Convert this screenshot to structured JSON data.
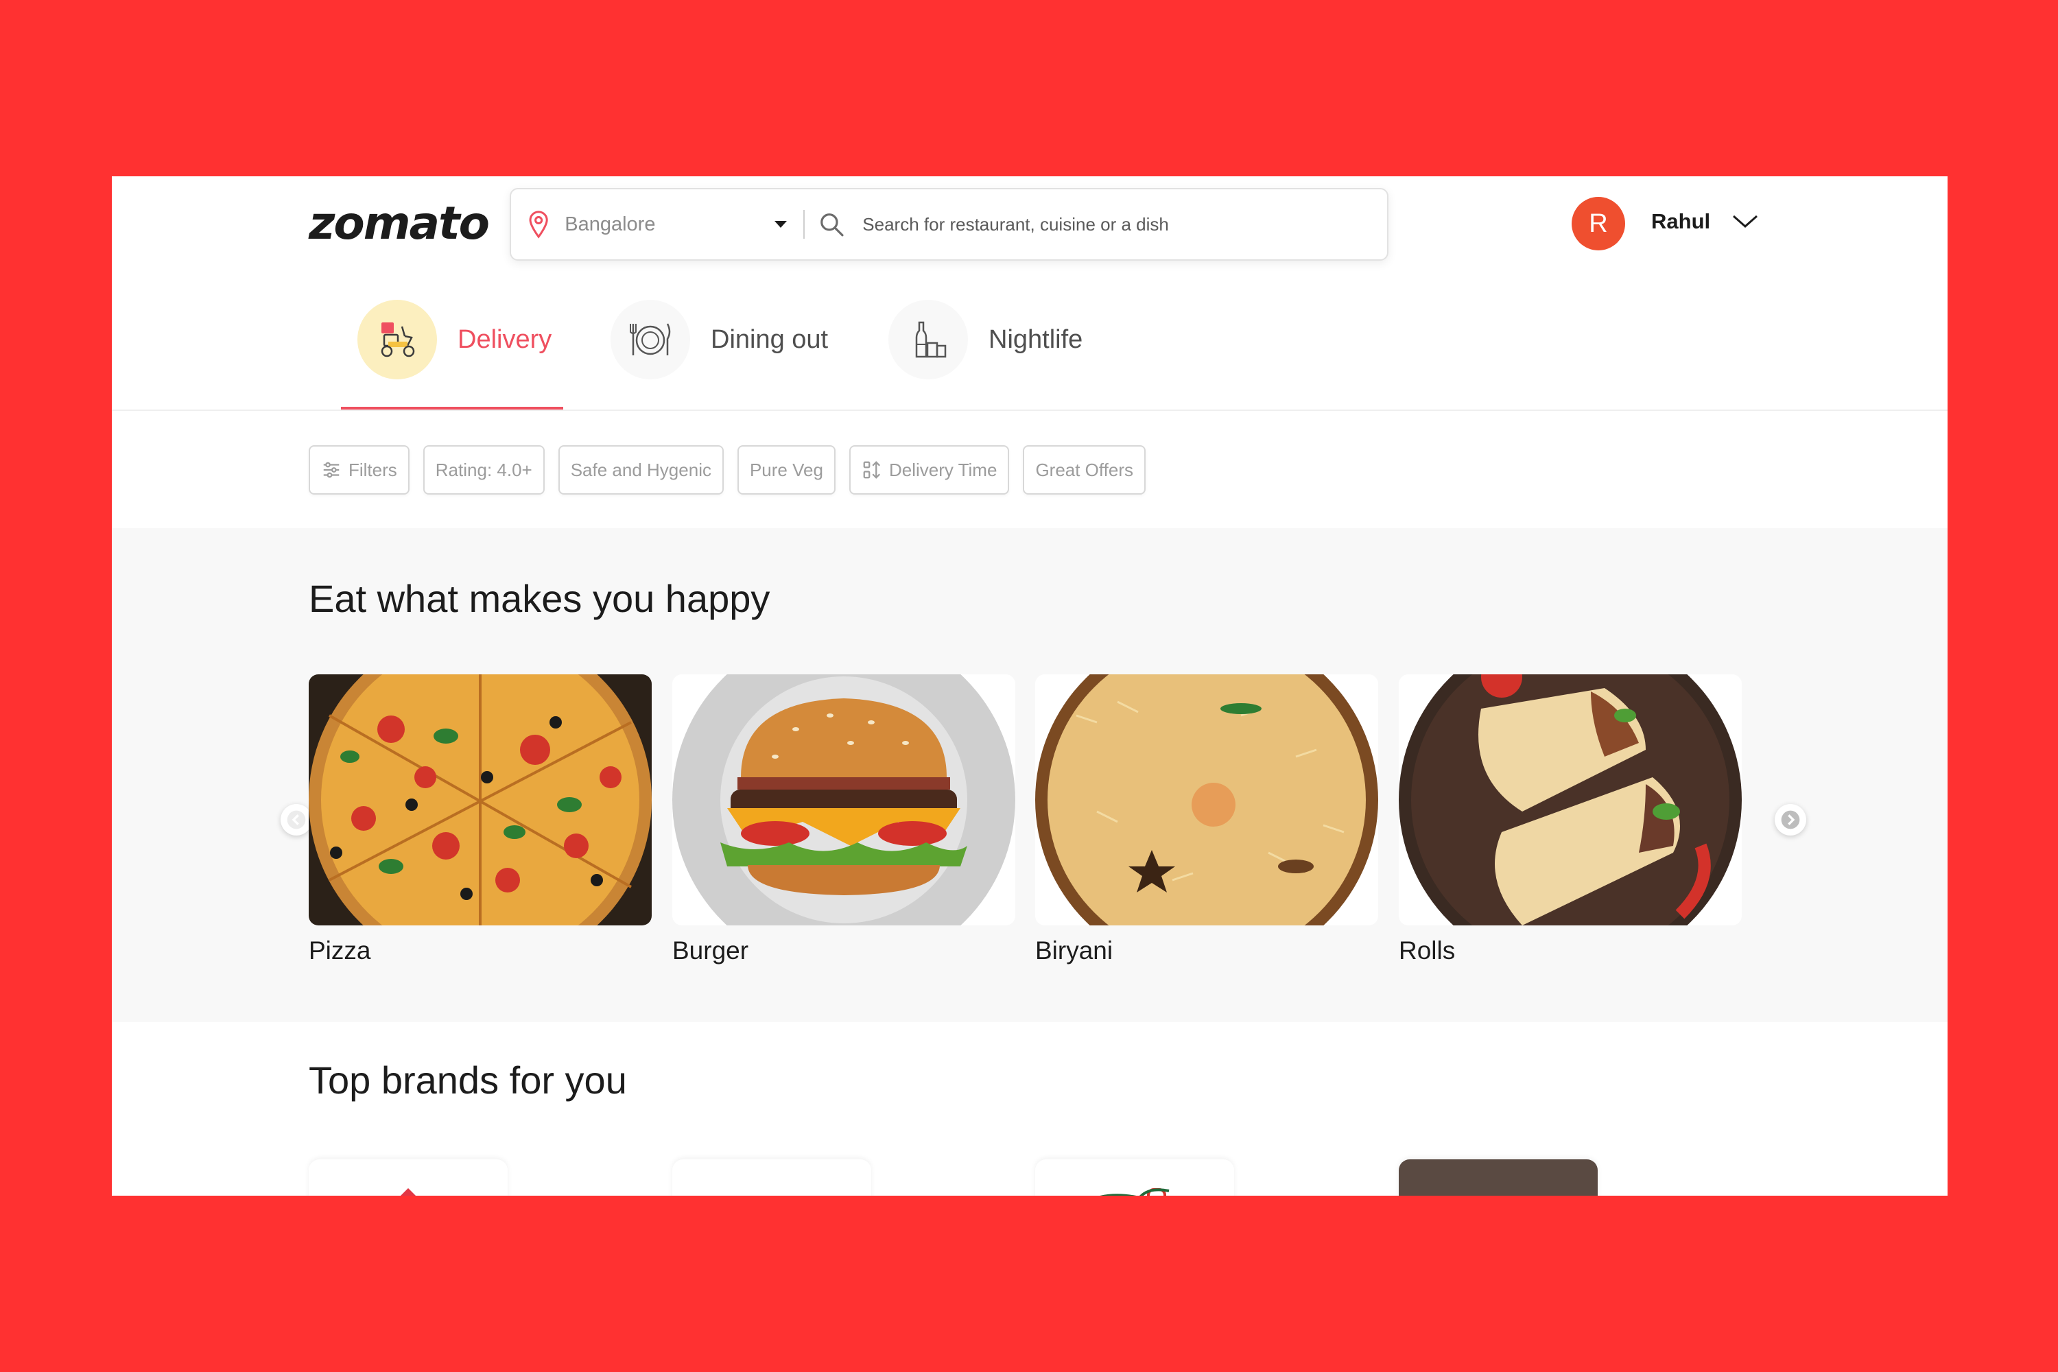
{
  "app": {
    "logo": "zomato"
  },
  "search": {
    "location": "Bangalore",
    "placeholder": "Search for restaurant, cuisine or a dish"
  },
  "user": {
    "initial": "R",
    "name": "Rahul"
  },
  "tabs": [
    {
      "label": "Delivery",
      "icon": "delivery-scooter-icon",
      "active": true
    },
    {
      "label": "Dining out",
      "icon": "dining-plate-icon",
      "active": false
    },
    {
      "label": "Nightlife",
      "icon": "nightlife-bottle-icon",
      "active": false
    }
  ],
  "filters": [
    {
      "label": "Filters",
      "icon": "sliders-icon"
    },
    {
      "label": "Rating: 4.0+"
    },
    {
      "label": "Safe and Hygenic"
    },
    {
      "label": "Pure Veg"
    },
    {
      "label": "Delivery Time",
      "icon": "sort-icon"
    },
    {
      "label": "Great Offers"
    }
  ],
  "eat_section": {
    "title": "Eat what makes you happy",
    "items": [
      {
        "label": "Pizza"
      },
      {
        "label": "Burger"
      },
      {
        "label": "Biryani"
      },
      {
        "label": "Rolls"
      }
    ]
  },
  "brands_section": {
    "title": "Top brands for you"
  },
  "colors": {
    "brand_red": "#ef4f5f",
    "background_red": "#ff3131",
    "avatar": "#ef4f2f",
    "delivery_icon_bg": "#fcefbf"
  }
}
